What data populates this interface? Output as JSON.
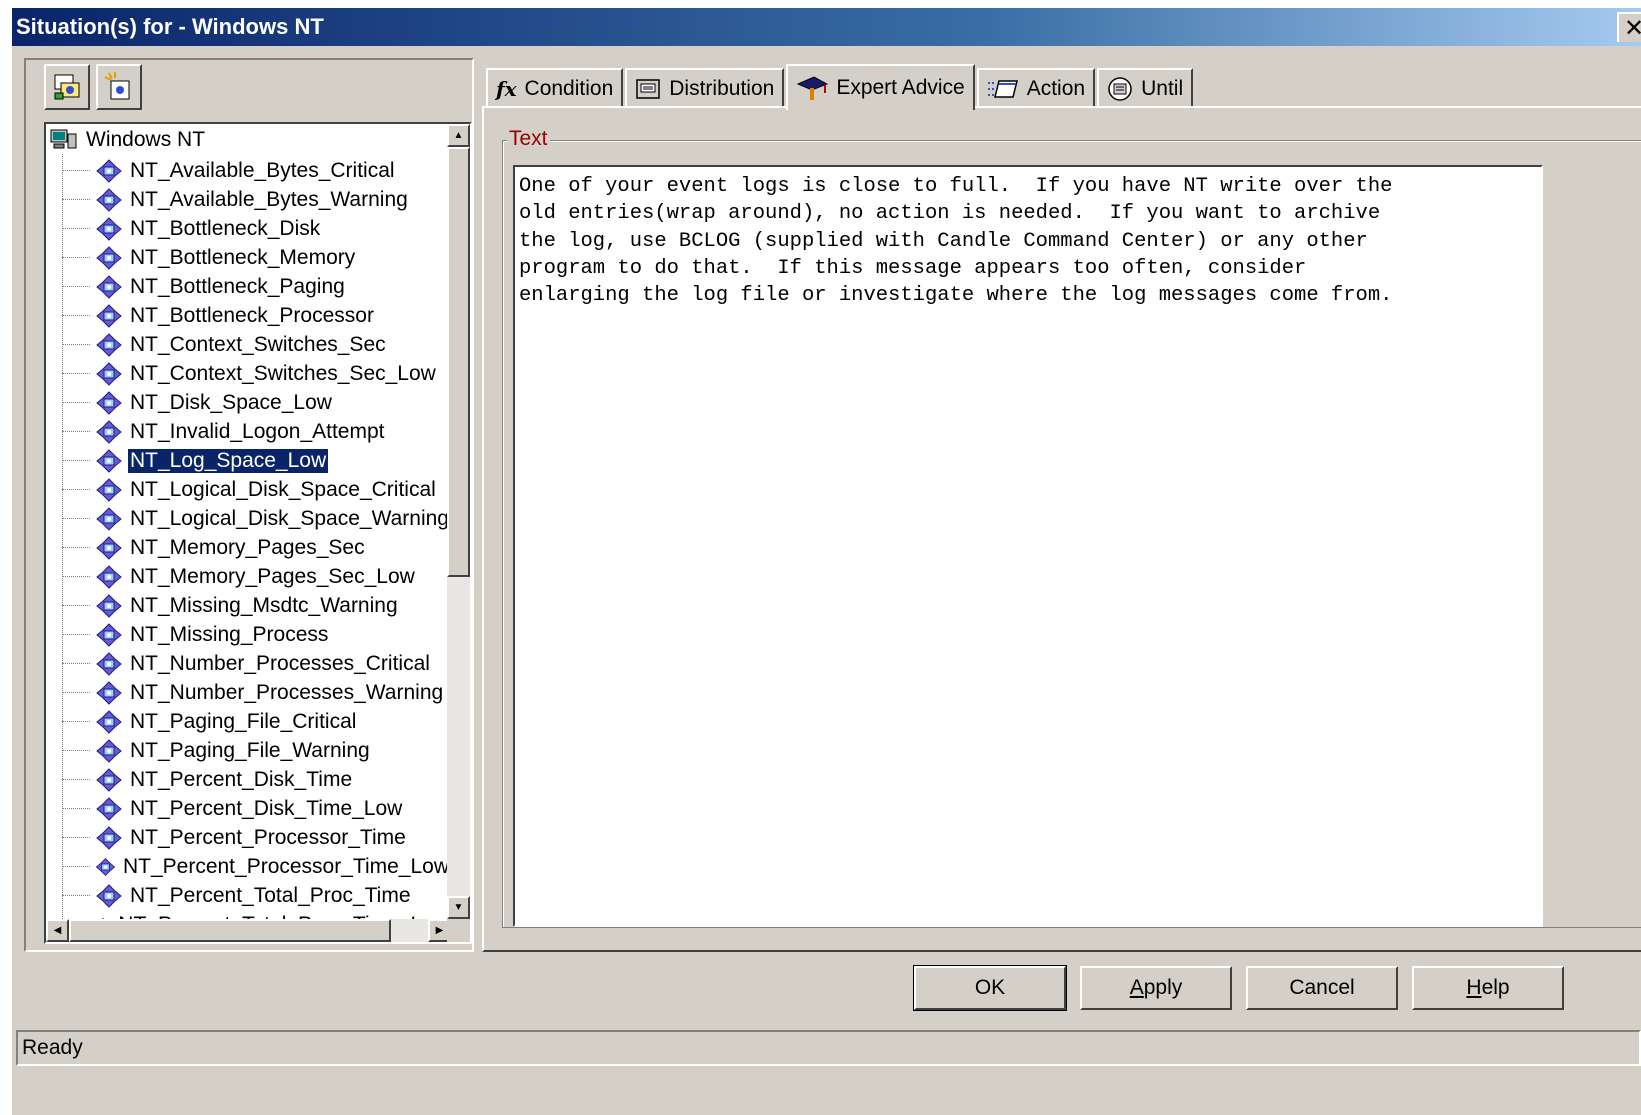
{
  "window": {
    "title": "Situation(s) for - Windows NT",
    "close_glyph": "✕"
  },
  "toolbar": {
    "buttons": [
      {
        "name": "create-situation-icon"
      },
      {
        "name": "create-another-situation-icon"
      }
    ]
  },
  "tree": {
    "root_label": "Windows NT",
    "selected_index": 10,
    "items": [
      "NT_Available_Bytes_Critical",
      "NT_Available_Bytes_Warning",
      "NT_Bottleneck_Disk",
      "NT_Bottleneck_Memory",
      "NT_Bottleneck_Paging",
      "NT_Bottleneck_Processor",
      "NT_Context_Switches_Sec",
      "NT_Context_Switches_Sec_Low",
      "NT_Disk_Space_Low",
      "NT_Invalid_Logon_Attempt",
      "NT_Log_Space_Low",
      "NT_Logical_Disk_Space_Critical",
      "NT_Logical_Disk_Space_Warning",
      "NT_Memory_Pages_Sec",
      "NT_Memory_Pages_Sec_Low",
      "NT_Missing_Msdtc_Warning",
      "NT_Missing_Process",
      "NT_Number_Processes_Critical",
      "NT_Number_Processes_Warning",
      "NT_Paging_File_Critical",
      "NT_Paging_File_Warning",
      "NT_Percent_Disk_Time",
      "NT_Percent_Disk_Time_Low",
      "NT_Percent_Processor_Time",
      "NT_Percent_Processor_Time_Low",
      "NT_Percent_Total_Proc_Time",
      "NT_Percent_Total_Proc_Time_Low"
    ]
  },
  "tabs": [
    {
      "label": "Condition",
      "icon": "fx-icon",
      "active": false
    },
    {
      "label": "Distribution",
      "icon": "distribution-icon",
      "active": false
    },
    {
      "label": "Expert Advice",
      "icon": "mortarboard-icon",
      "active": true
    },
    {
      "label": "Action",
      "icon": "action-icon",
      "active": false
    },
    {
      "label": "Until",
      "icon": "until-icon",
      "active": false
    }
  ],
  "expert_advice": {
    "group_label": "Text",
    "text": "One of your event logs is close to full.  If you have NT write over the\nold entries(wrap around), no action is needed.  If you want to archive\nthe log, use BCLOG (supplied with Candle Command Center) or any other\nprogram to do that.  If this message appears too often, consider\nenlarging the log file or investigate where the log messages come from."
  },
  "buttons": {
    "ok": "OK",
    "apply_prefix": "A",
    "apply_rest": "pply",
    "cancel": "Cancel",
    "help_prefix": "H",
    "help_rest": "elp"
  },
  "status": "Ready",
  "colors": {
    "titlebar": "#0a246a",
    "selection": "#0a246a",
    "group_label": "#990000",
    "face": "#d4d0c8"
  }
}
